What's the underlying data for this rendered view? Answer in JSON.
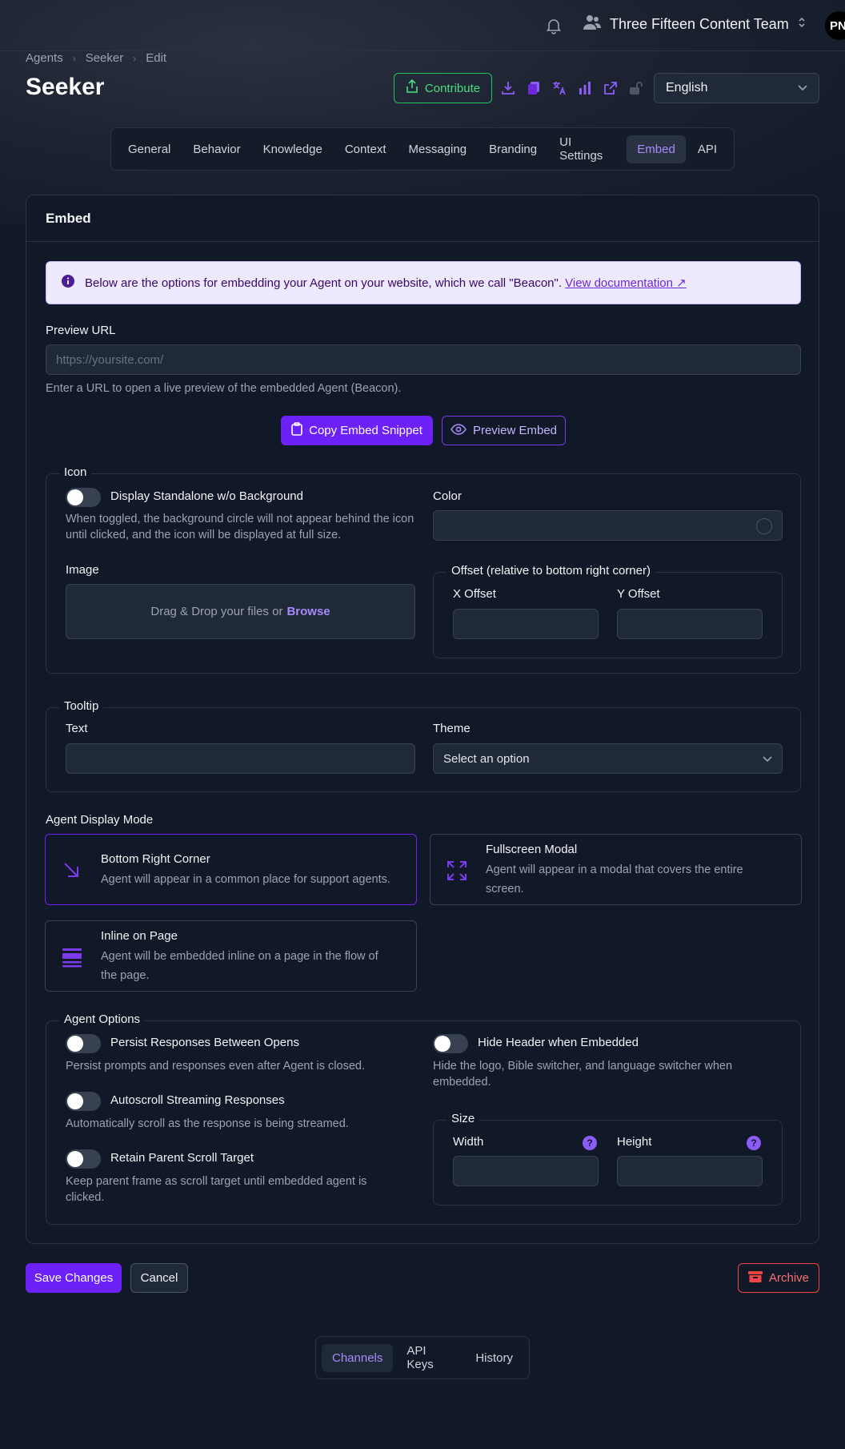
{
  "header": {
    "team_name": "Three Fifteen Content Team",
    "avatar_initials": "PN"
  },
  "breadcrumb": [
    "Agents",
    "Seeker",
    "Edit"
  ],
  "page_title": "Seeker",
  "toolbar": {
    "contribute_label": "Contribute",
    "language": "English",
    "icons": [
      "download-icon",
      "copy-icon",
      "translate-icon",
      "chart-icon",
      "external-link-icon",
      "lock-icon"
    ]
  },
  "tabs": [
    "General",
    "Behavior",
    "Knowledge",
    "Context",
    "Messaging",
    "Branding",
    "UI Settings",
    "Embed",
    "API"
  ],
  "active_tab": "Embed",
  "card": {
    "title": "Embed",
    "info_text": "Below are the options for embedding your Agent on your website, which we call \"Beacon\".",
    "info_link": "View documentation ↗",
    "preview_url_label": "Preview URL",
    "preview_url_placeholder": "https://yoursite.com/",
    "preview_url_hint": "Enter a URL to open a live preview of the embedded Agent (Beacon).",
    "copy_snippet_label": "Copy Embed Snippet",
    "preview_embed_label": "Preview Embed"
  },
  "icon_section": {
    "legend": "Icon",
    "standalone_label": "Display Standalone w/o Background",
    "standalone_hint": "When toggled, the background circle will not appear behind the icon until clicked, and the icon will be displayed at full size.",
    "color_label": "Color",
    "image_label": "Image",
    "dropzone_text": "Drag & Drop your files or",
    "dropzone_browse": "Browse",
    "offset_legend": "Offset (relative to bottom right corner)",
    "x_offset_label": "X Offset",
    "y_offset_label": "Y Offset"
  },
  "tooltip_section": {
    "legend": "Tooltip",
    "text_label": "Text",
    "theme_label": "Theme",
    "theme_value": "Select an option"
  },
  "display_mode": {
    "label": "Agent Display Mode",
    "options": [
      {
        "title": "Bottom Right Corner",
        "desc": "Agent will appear in a common place for support agents."
      },
      {
        "title": "Fullscreen Modal",
        "desc": "Agent will appear in a modal that covers the entire screen."
      },
      {
        "title": "Inline on Page",
        "desc": "Agent will be embedded inline on a page in the flow of the page."
      }
    ]
  },
  "agent_options": {
    "legend": "Agent Options",
    "persist_label": "Persist Responses Between Opens",
    "persist_hint": "Persist prompts and responses even after Agent is closed.",
    "autoscroll_label": "Autoscroll Streaming Responses",
    "autoscroll_hint": "Automatically scroll as the response is being streamed.",
    "retain_label": "Retain Parent Scroll Target",
    "retain_hint": "Keep parent frame as scroll target until embedded agent is clicked.",
    "hide_header_label": "Hide Header when Embedded",
    "hide_header_hint": "Hide the logo, Bible switcher, and language switcher when embedded.",
    "size_legend": "Size",
    "width_label": "Width",
    "height_label": "Height",
    "help_glyph": "?"
  },
  "actions": {
    "save_label": "Save Changes",
    "cancel_label": "Cancel",
    "archive_label": "Archive"
  },
  "bottom_tabs": [
    "Channels",
    "API Keys",
    "History"
  ],
  "colors": {
    "accent": "#6b21f8",
    "success": "#22c55e",
    "danger": "#ef4444"
  }
}
